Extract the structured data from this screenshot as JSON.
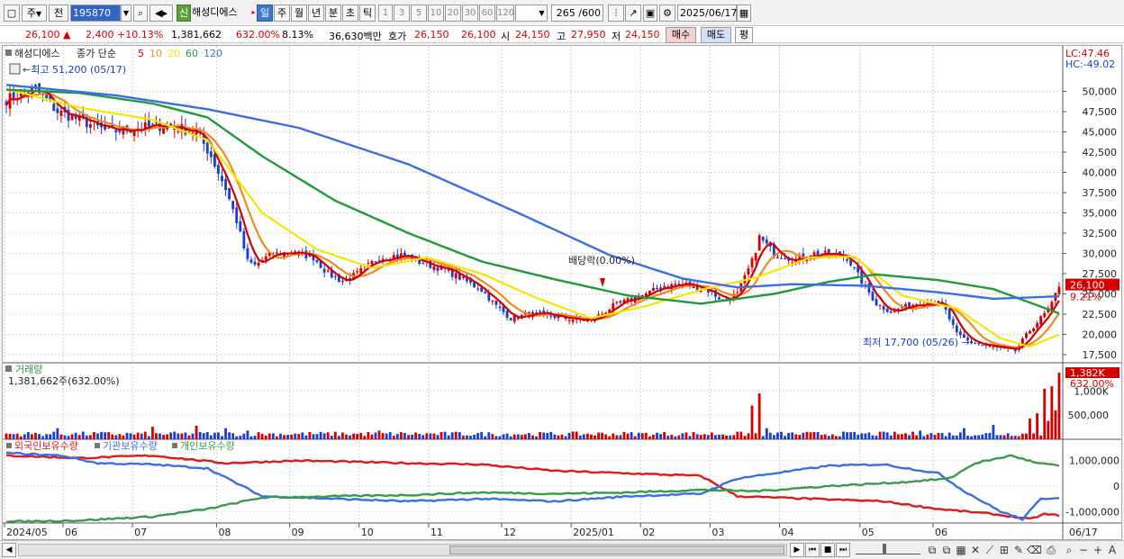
{
  "toolbar": {
    "chart_type": "주",
    "market": "전",
    "code": "195870",
    "badge": "신",
    "name": "해성디에스",
    "periods": [
      "일",
      "주",
      "월",
      "년",
      "분",
      "초",
      "틱"
    ],
    "intervals": [
      "1",
      "3",
      "5",
      "10",
      "20",
      "30",
      "60",
      "120"
    ],
    "count": "265 /600",
    "date": "2025/06/17"
  },
  "quote": {
    "price": "26,100",
    "change": "2,400 +10.13%",
    "volume": "1,381,662",
    "volume_ratio": "632.00%",
    "turnover": "8.13%",
    "trade_value": "36,630백만",
    "ask_label": "호가",
    "ask": "26,150",
    "bid": "26,100",
    "open_label": "시",
    "open": "24,150",
    "high_label": "고",
    "high": "27,950",
    "low_label": "저",
    "low": "24,150",
    "buy_label": "매수",
    "sell_label": "매도",
    "eval_label": "평"
  },
  "colors": {
    "up": "#d40000",
    "down": "#1a3fd0",
    "ma5": "#d40000",
    "ma10": "#f08a1e",
    "ma20": "#f5e600",
    "ma60": "#1f9a3a",
    "ma120": "#3a6ee6",
    "foreign": "#e01818",
    "institution": "#3a6ee6",
    "individual": "#3a9a4a"
  },
  "chart_data": [
    {
      "type": "candlestick",
      "title": "해성디에스",
      "legend": [
        "종가 단순",
        "5",
        "10",
        "20",
        "60",
        "120"
      ],
      "legend_colors": [
        "#d40000",
        "#d40000",
        "#f08a1e",
        "#f5e600",
        "#1f9a3a",
        "#3a6ee6"
      ],
      "ylim": [
        16500,
        52500
      ],
      "yticks": [
        17500,
        20000,
        22500,
        25000,
        27500,
        30000,
        32500,
        35000,
        37500,
        40000,
        42500,
        45000,
        47500,
        50000
      ],
      "ytick_labels": [
        "17,500",
        "20,000",
        "22,500",
        "25,000",
        "27,500",
        "30,000",
        "32,500",
        "35,000",
        "37,500",
        "40,000",
        "42,500",
        "45,000",
        "47,500",
        "50,000"
      ],
      "anchors_close": [
        [
          0,
          49000
        ],
        [
          8,
          50200
        ],
        [
          14,
          47500
        ],
        [
          20,
          46500
        ],
        [
          28,
          45000
        ],
        [
          36,
          45500
        ],
        [
          44,
          45800
        ],
        [
          52,
          45000
        ],
        [
          56,
          42000
        ],
        [
          60,
          38000
        ],
        [
          63,
          34000
        ],
        [
          66,
          29000
        ],
        [
          68,
          28500
        ],
        [
          72,
          29800
        ],
        [
          78,
          30200
        ],
        [
          84,
          29500
        ],
        [
          88,
          27500
        ],
        [
          92,
          26500
        ],
        [
          96,
          27500
        ],
        [
          102,
          29500
        ],
        [
          108,
          29800
        ],
        [
          114,
          28800
        ],
        [
          120,
          28000
        ],
        [
          126,
          26500
        ],
        [
          130,
          25500
        ],
        [
          134,
          23500
        ],
        [
          138,
          22000
        ],
        [
          144,
          22500
        ],
        [
          150,
          22200
        ],
        [
          156,
          21800
        ],
        [
          160,
          21700
        ],
        [
          166,
          23500
        ],
        [
          172,
          24500
        ],
        [
          176,
          25200
        ],
        [
          180,
          26000
        ],
        [
          186,
          26200
        ],
        [
          192,
          25400
        ],
        [
          196,
          24200
        ],
        [
          200,
          25000
        ],
        [
          204,
          29000
        ],
        [
          206,
          32000
        ],
        [
          210,
          30000
        ],
        [
          216,
          29200
        ],
        [
          220,
          30000
        ],
        [
          226,
          29800
        ],
        [
          230,
          29500
        ],
        [
          234,
          26500
        ],
        [
          238,
          23800
        ],
        [
          242,
          22800
        ],
        [
          246,
          23400
        ],
        [
          250,
          24000
        ],
        [
          256,
          23800
        ],
        [
          260,
          20000
        ],
        [
          264,
          19000
        ],
        [
          268,
          18600
        ],
        [
          272,
          18200
        ],
        [
          276,
          17950
        ],
        [
          280,
          20500
        ],
        [
          284,
          22500
        ],
        [
          286,
          23700
        ],
        [
          288,
          26100
        ]
      ],
      "ma_anchors": {
        "ma20": [
          [
            0,
            50300
          ],
          [
            20,
            48000
          ],
          [
            40,
            46500
          ],
          [
            55,
            44000
          ],
          [
            70,
            35000
          ],
          [
            85,
            30500
          ],
          [
            100,
            28200
          ],
          [
            115,
            29500
          ],
          [
            130,
            27500
          ],
          [
            145,
            24500
          ],
          [
            160,
            22000
          ],
          [
            175,
            23500
          ],
          [
            190,
            25500
          ],
          [
            205,
            27000
          ],
          [
            220,
            29500
          ],
          [
            232,
            29600
          ],
          [
            245,
            24800
          ],
          [
            260,
            23200
          ],
          [
            272,
            19500
          ],
          [
            280,
            18500
          ],
          [
            288,
            20000
          ]
        ],
        "ma60": [
          [
            0,
            50200
          ],
          [
            20,
            49800
          ],
          [
            40,
            48500
          ],
          [
            55,
            46800
          ],
          [
            70,
            42000
          ],
          [
            90,
            36500
          ],
          [
            110,
            32500
          ],
          [
            130,
            29000
          ],
          [
            150,
            26800
          ],
          [
            170,
            24800
          ],
          [
            190,
            23800
          ],
          [
            210,
            25000
          ],
          [
            225,
            26500
          ],
          [
            238,
            27400
          ],
          [
            255,
            26700
          ],
          [
            270,
            25600
          ],
          [
            288,
            22600
          ]
        ],
        "ma120": [
          [
            0,
            50800
          ],
          [
            30,
            49500
          ],
          [
            55,
            47800
          ],
          [
            80,
            45500
          ],
          [
            110,
            41000
          ],
          [
            140,
            35000
          ],
          [
            165,
            29800
          ],
          [
            185,
            26900
          ],
          [
            200,
            25800
          ],
          [
            215,
            26200
          ],
          [
            235,
            26000
          ],
          [
            255,
            25200
          ],
          [
            270,
            24400
          ],
          [
            288,
            24700
          ]
        ]
      },
      "annotations": {
        "high_label": "최고 51,200 (05/17)",
        "low_label": "최저 17,700 (05/26)",
        "dividend_label": "배당락(0.00%)"
      },
      "right_labels": {
        "lc": "LC:47.46",
        "hc": "HC:-49.02",
        "price": "26,100",
        "change_pct": "9.21%"
      }
    },
    {
      "type": "bar",
      "title": "거래량",
      "subtitle": "1,381,662주(632.00%)",
      "ytick_labels": [
        "500,000",
        "1,000K"
      ],
      "yticks": [
        500000,
        1000000
      ],
      "ylim": [
        0,
        1400000
      ],
      "spikes": [
        [
          14,
          230000
        ],
        [
          40,
          260000
        ],
        [
          52,
          280000
        ],
        [
          60,
          230000
        ],
        [
          66,
          180000
        ],
        [
          102,
          180000
        ],
        [
          146,
          150000
        ],
        [
          204,
          700000
        ],
        [
          206,
          950000
        ],
        [
          208,
          230000
        ],
        [
          250,
          180000
        ],
        [
          262,
          230000
        ],
        [
          270,
          300000
        ],
        [
          280,
          430000
        ],
        [
          282,
          540000
        ],
        [
          284,
          1050000
        ],
        [
          285,
          380000
        ],
        [
          286,
          1100000
        ],
        [
          287,
          600000
        ],
        [
          288,
          1382000
        ]
      ],
      "right_labels": {
        "value": "1,382K",
        "pct": "632.00%"
      }
    },
    {
      "type": "line",
      "legend": [
        "외국인보유수량",
        "기관보유수량",
        "개인보유수량"
      ],
      "ytick_labels": [
        "1,000,000",
        "0",
        "-1,000,000"
      ],
      "yticks": [
        1000000,
        0,
        -1000000
      ],
      "ylim": [
        -1450000,
        1450000
      ],
      "series": [
        {
          "name": "외국인보유수량",
          "anchors": [
            [
              0,
              1200000
            ],
            [
              20,
              1100000
            ],
            [
              40,
              1200000
            ],
            [
              60,
              900000
            ],
            [
              80,
              1000000
            ],
            [
              110,
              900000
            ],
            [
              130,
              850000
            ],
            [
              150,
              600000
            ],
            [
              170,
              500000
            ],
            [
              190,
              400000
            ],
            [
              200,
              -400000
            ],
            [
              220,
              -500000
            ],
            [
              240,
              -600000
            ],
            [
              255,
              -900000
            ],
            [
              270,
              -1100000
            ],
            [
              280,
              -1300000
            ],
            [
              284,
              -1100000
            ],
            [
              288,
              -1150000
            ]
          ]
        },
        {
          "name": "기관보유수량",
          "anchors": [
            [
              0,
              1300000
            ],
            [
              15,
              1200000
            ],
            [
              25,
              900000
            ],
            [
              40,
              850000
            ],
            [
              55,
              700000
            ],
            [
              70,
              -400000
            ],
            [
              90,
              -500000
            ],
            [
              110,
              -600000
            ],
            [
              130,
              -500000
            ],
            [
              150,
              -600000
            ],
            [
              170,
              -400000
            ],
            [
              190,
              -300000
            ],
            [
              200,
              300000
            ],
            [
              210,
              500000
            ],
            [
              225,
              800000
            ],
            [
              240,
              850000
            ],
            [
              255,
              500000
            ],
            [
              262,
              -200000
            ],
            [
              272,
              -1000000
            ],
            [
              278,
              -1300000
            ],
            [
              283,
              -500000
            ],
            [
              288,
              -450000
            ]
          ]
        },
        {
          "name": "개인보유수량",
          "anchors": [
            [
              0,
              -1400000
            ],
            [
              20,
              -1350000
            ],
            [
              40,
              -1200000
            ],
            [
              55,
              -900000
            ],
            [
              70,
              -450000
            ],
            [
              90,
              -400000
            ],
            [
              110,
              -350000
            ],
            [
              130,
              -250000
            ],
            [
              150,
              -300000
            ],
            [
              170,
              -250000
            ],
            [
              190,
              -150000
            ],
            [
              205,
              -200000
            ],
            [
              225,
              0
            ],
            [
              245,
              150000
            ],
            [
              258,
              300000
            ],
            [
              265,
              900000
            ],
            [
              275,
              1200000
            ],
            [
              282,
              900000
            ],
            [
              288,
              800000
            ]
          ]
        }
      ]
    }
  ],
  "x_axis": {
    "labels": [
      "2024/05",
      "06",
      "07",
      "08",
      "09",
      "10",
      "11",
      "12",
      "2025/01",
      "02",
      "03",
      "04",
      "05",
      "06"
    ],
    "positions": [
      0,
      16,
      35,
      58,
      78,
      97,
      116,
      136,
      155,
      174,
      193,
      212,
      234,
      254
    ],
    "last_label": "06/17",
    "total_bars": 289
  }
}
